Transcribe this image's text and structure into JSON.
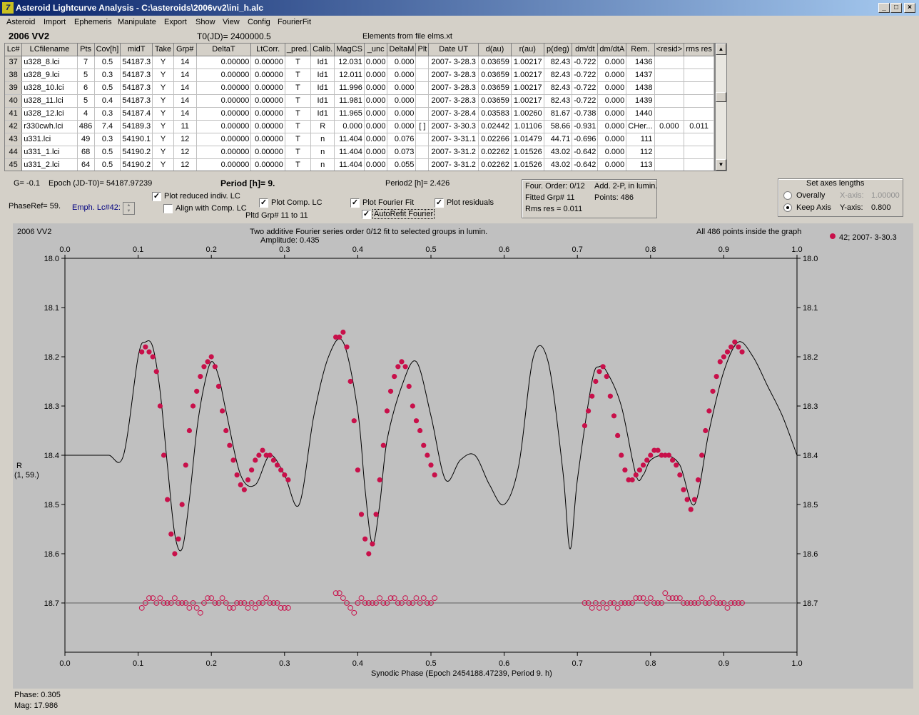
{
  "window": {
    "title": "Asteroid Lightcurve Analysis - C:\\asteroids\\2006vv2\\ini_h.alc",
    "app_icon": "lightcurve-app-icon",
    "minimize": "_",
    "maximize": "□",
    "close": "×"
  },
  "menu": [
    "Asteroid",
    "Import",
    "Ephemeris",
    "Manipulate",
    "Export",
    "Show",
    "View",
    "Config",
    "FourierFit"
  ],
  "header": {
    "object": "2006 VV2",
    "t0": "T0(JD)= 2400000.5",
    "elements": "Elements from file elms.xt"
  },
  "table": {
    "columns": [
      "Lc#",
      "LCfilename",
      "Pts",
      "Cov[h]",
      "midT",
      "Take",
      "Grp#",
      "DeltaT",
      "LtCorr.",
      "_pred.",
      "Calib.",
      "MagCS",
      "_unc",
      "DeltaM",
      "Plt",
      "Date UT",
      "d(au)",
      "r(au)",
      "p(deg)",
      "dm/dt",
      "dm/dtA",
      "Rem.",
      "<resid>",
      "rms res"
    ],
    "rows": [
      [
        "37",
        "u328_8.lci",
        "7",
        "0.5",
        "54187.3",
        "Y",
        "14",
        "0.00000",
        "0.00000",
        "T",
        "Id1",
        "12.031",
        "0.000",
        "0.000",
        "",
        "2007- 3-28.3",
        "0.03659",
        "1.00217",
        "82.43",
        "-0.722",
        "0.000",
        "1436",
        "",
        ""
      ],
      [
        "38",
        "u328_9.lci",
        "5",
        "0.3",
        "54187.3",
        "Y",
        "14",
        "0.00000",
        "0.00000",
        "T",
        "Id1",
        "12.011",
        "0.000",
        "0.000",
        "",
        "2007- 3-28.3",
        "0.03659",
        "1.00217",
        "82.43",
        "-0.722",
        "0.000",
        "1437",
        "",
        ""
      ],
      [
        "39",
        "u328_10.lci",
        "6",
        "0.5",
        "54187.3",
        "Y",
        "14",
        "0.00000",
        "0.00000",
        "T",
        "Id1",
        "11.996",
        "0.000",
        "0.000",
        "",
        "2007- 3-28.3",
        "0.03659",
        "1.00217",
        "82.43",
        "-0.722",
        "0.000",
        "1438",
        "",
        ""
      ],
      [
        "40",
        "u328_11.lci",
        "5",
        "0.4",
        "54187.3",
        "Y",
        "14",
        "0.00000",
        "0.00000",
        "T",
        "Id1",
        "11.981",
        "0.000",
        "0.000",
        "",
        "2007- 3-28.3",
        "0.03659",
        "1.00217",
        "82.43",
        "-0.722",
        "0.000",
        "1439",
        "",
        ""
      ],
      [
        "41",
        "u328_12.lci",
        "4",
        "0.3",
        "54187.4",
        "Y",
        "14",
        "0.00000",
        "0.00000",
        "T",
        "Id1",
        "11.965",
        "0.000",
        "0.000",
        "",
        "2007- 3-28.4",
        "0.03583",
        "1.00260",
        "81.67",
        "-0.738",
        "0.000",
        "1440",
        "",
        ""
      ],
      [
        "42",
        "r330cwh.lci",
        "486",
        "7.4",
        "54189.3",
        "Y",
        "11",
        "0.00000",
        "0.00000",
        "T",
        "R",
        "0.000",
        "0.000",
        "0.000",
        "[ ]",
        "2007- 3-30.3",
        "0.02442",
        "1.01106",
        "58.66",
        "-0.931",
        "0.000",
        "CHer...",
        "0.000",
        "0.011"
      ],
      [
        "43",
        "u331.lci",
        "49",
        "0.3",
        "54190.1",
        "Y",
        "12",
        "0.00000",
        "0.00000",
        "T",
        "n",
        "11.404",
        "0.000",
        "0.076",
        "",
        "2007- 3-31.1",
        "0.02266",
        "1.01479",
        "44.71",
        "-0.696",
        "0.000",
        "111",
        "",
        ""
      ],
      [
        "44",
        "u331_1.lci",
        "68",
        "0.5",
        "54190.2",
        "Y",
        "12",
        "0.00000",
        "0.00000",
        "T",
        "n",
        "11.404",
        "0.000",
        "0.073",
        "",
        "2007- 3-31.2",
        "0.02262",
        "1.01526",
        "43.02",
        "-0.642",
        "0.000",
        "112",
        "",
        ""
      ],
      [
        "45",
        "u331_2.lci",
        "64",
        "0.5",
        "54190.2",
        "Y",
        "12",
        "0.00000",
        "0.00000",
        "T",
        "n",
        "11.404",
        "0.000",
        "0.055",
        "",
        "2007- 3-31.2",
        "0.02262",
        "1.01526",
        "43.02",
        "-0.642",
        "0.000",
        "113",
        "",
        ""
      ]
    ]
  },
  "controls": {
    "g": "G= -0.1",
    "epoch": "Epoch (JD-T0)= 54187.97239",
    "period": "Period [h]= 9.",
    "period2": "Period2 [h]= 2.426",
    "phase_ref": "PhaseRef= 59.",
    "emph": "Emph. Lc#42:",
    "plot_reduced": "Plot reduced indiv. LC",
    "align_comp": "Align with Comp. LC",
    "plot_comp": "Plot Comp. LC",
    "pltd_grp": "Pltd Grp#  11 to   11",
    "plot_fourier": "Plot Fourier Fit",
    "autorefit": "AutoRefit Fourier",
    "plot_residuals": "Plot residuals"
  },
  "fourier_info": {
    "order": "Four. Order:  0/12",
    "add": "Add. 2-P, in lumin.",
    "fitted": "Fitted Grp# 11",
    "points": "Points: 486",
    "rms": "Rms res     = 0.011"
  },
  "axes_group": {
    "title": "Set axes lengths",
    "overally": "Overally",
    "keep_axis": "Keep Axis",
    "x_label": "X-axis:",
    "x_value": "1.00000",
    "y_label": "Y-axis:",
    "y_value": "0.800"
  },
  "plot": {
    "object": "2006 VV2",
    "subtitle": "Two additive Fourier series order 0/12 fit to selected groups in lumin.",
    "amplitude": "Amplitude: 0.435",
    "points_note": "All 486 points inside the graph",
    "legend": "42; 2007- 3-30.3",
    "ylabel_1": "R",
    "ylabel_2": "(1, 59.)",
    "xlabel": "Synodic Phase (Epoch 2454188.47239, Period 9. h)",
    "phase_readout": "Phase:  0.305",
    "mag_readout": "Mag:    17.986"
  },
  "chart_data": {
    "type": "scatter",
    "xlabel": "Synodic Phase (Epoch 2454188.47239, Period 9. h)",
    "ylabel": "R",
    "xlim": [
      0.0,
      1.0
    ],
    "ylim": [
      18.0,
      18.8
    ],
    "y_inverted": true,
    "xticks": [
      "0.0",
      "0.1",
      "0.2",
      "0.3",
      "0.4",
      "0.5",
      "0.6",
      "0.7",
      "0.8",
      "0.9",
      "1.0"
    ],
    "yticks": [
      "18.0",
      "18.1",
      "18.2",
      "18.3",
      "18.4",
      "18.5",
      "18.6",
      "18.7"
    ],
    "grid": false,
    "legend_position": "top-right",
    "colors": {
      "points": "#c8104a",
      "fit": "#000000",
      "residual_line": "#606060"
    },
    "fourier_fit": {
      "x": [
        0.0,
        0.02,
        0.04,
        0.06,
        0.08,
        0.1,
        0.11,
        0.12,
        0.13,
        0.14,
        0.15,
        0.16,
        0.17,
        0.18,
        0.19,
        0.2,
        0.21,
        0.22,
        0.24,
        0.26,
        0.28,
        0.3,
        0.32,
        0.34,
        0.36,
        0.38,
        0.4,
        0.41,
        0.42,
        0.43,
        0.44,
        0.46,
        0.48,
        0.5,
        0.52,
        0.54,
        0.56,
        0.58,
        0.6,
        0.62,
        0.64,
        0.66,
        0.68,
        0.69,
        0.7,
        0.72,
        0.73,
        0.74,
        0.76,
        0.78,
        0.79,
        0.8,
        0.82,
        0.84,
        0.86,
        0.88,
        0.9,
        0.92,
        0.94,
        0.96,
        0.98,
        1.0
      ],
      "y": [
        18.4,
        18.4,
        18.4,
        18.4,
        18.4,
        18.2,
        18.17,
        18.18,
        18.27,
        18.42,
        18.56,
        18.59,
        18.49,
        18.35,
        18.26,
        18.21,
        18.24,
        18.31,
        18.44,
        18.46,
        18.4,
        18.44,
        18.5,
        18.32,
        18.2,
        18.17,
        18.31,
        18.47,
        18.58,
        18.5,
        18.37,
        18.26,
        18.21,
        18.32,
        18.45,
        18.41,
        18.4,
        18.46,
        18.5,
        18.42,
        18.2,
        18.21,
        18.43,
        18.59,
        18.45,
        18.25,
        18.22,
        18.23,
        18.3,
        18.44,
        18.44,
        18.41,
        18.4,
        18.42,
        18.5,
        18.35,
        18.23,
        18.17,
        18.2,
        18.26,
        18.32,
        18.4
      ]
    },
    "observed_points": {
      "x": [
        0.105,
        0.11,
        0.115,
        0.12,
        0.125,
        0.13,
        0.135,
        0.14,
        0.145,
        0.15,
        0.155,
        0.16,
        0.165,
        0.17,
        0.175,
        0.18,
        0.185,
        0.19,
        0.195,
        0.2,
        0.205,
        0.21,
        0.215,
        0.22,
        0.225,
        0.23,
        0.235,
        0.24,
        0.245,
        0.25,
        0.255,
        0.26,
        0.265,
        0.27,
        0.275,
        0.28,
        0.285,
        0.29,
        0.295,
        0.3,
        0.305,
        0.37,
        0.375,
        0.38,
        0.385,
        0.39,
        0.395,
        0.4,
        0.405,
        0.41,
        0.415,
        0.42,
        0.425,
        0.43,
        0.435,
        0.44,
        0.445,
        0.45,
        0.455,
        0.46,
        0.465,
        0.47,
        0.475,
        0.48,
        0.485,
        0.49,
        0.495,
        0.5,
        0.505,
        0.71,
        0.715,
        0.72,
        0.725,
        0.73,
        0.735,
        0.74,
        0.745,
        0.75,
        0.755,
        0.76,
        0.765,
        0.77,
        0.775,
        0.78,
        0.785,
        0.79,
        0.795,
        0.8,
        0.805,
        0.81,
        0.815,
        0.82,
        0.825,
        0.83,
        0.835,
        0.84,
        0.845,
        0.85,
        0.855,
        0.86,
        0.865,
        0.87,
        0.875,
        0.88,
        0.885,
        0.89,
        0.895,
        0.9,
        0.905,
        0.91,
        0.915,
        0.92,
        0.925
      ],
      "y": [
        18.19,
        18.18,
        18.19,
        18.2,
        18.23,
        18.3,
        18.4,
        18.49,
        18.56,
        18.6,
        18.57,
        18.5,
        18.42,
        18.35,
        18.3,
        18.27,
        18.24,
        18.22,
        18.21,
        18.2,
        18.22,
        18.26,
        18.31,
        18.35,
        18.38,
        18.41,
        18.44,
        18.46,
        18.47,
        18.45,
        18.43,
        18.41,
        18.4,
        18.39,
        18.4,
        18.4,
        18.41,
        18.42,
        18.43,
        18.44,
        18.45,
        18.16,
        18.16,
        18.15,
        18.18,
        18.25,
        18.33,
        18.43,
        18.52,
        18.57,
        18.6,
        18.58,
        18.52,
        18.45,
        18.38,
        18.31,
        18.27,
        18.24,
        18.22,
        18.21,
        18.22,
        18.26,
        18.3,
        18.33,
        18.35,
        18.38,
        18.4,
        18.42,
        18.44,
        18.34,
        18.31,
        18.28,
        18.25,
        18.23,
        18.22,
        18.24,
        18.28,
        18.32,
        18.36,
        18.4,
        18.43,
        18.45,
        18.45,
        18.44,
        18.43,
        18.42,
        18.41,
        18.4,
        18.39,
        18.39,
        18.4,
        18.4,
        18.4,
        18.41,
        18.42,
        18.44,
        18.47,
        18.49,
        18.51,
        18.49,
        18.45,
        18.4,
        18.35,
        18.31,
        18.27,
        18.24,
        18.21,
        18.2,
        18.19,
        18.18,
        18.17,
        18.18,
        18.19
      ]
    },
    "residuals": {
      "x": [
        0.105,
        0.11,
        0.115,
        0.12,
        0.125,
        0.13,
        0.135,
        0.14,
        0.145,
        0.15,
        0.155,
        0.16,
        0.165,
        0.17,
        0.175,
        0.18,
        0.185,
        0.19,
        0.195,
        0.2,
        0.205,
        0.21,
        0.215,
        0.22,
        0.225,
        0.23,
        0.235,
        0.24,
        0.245,
        0.25,
        0.255,
        0.26,
        0.265,
        0.27,
        0.275,
        0.28,
        0.285,
        0.29,
        0.295,
        0.3,
        0.305,
        0.37,
        0.375,
        0.38,
        0.385,
        0.39,
        0.395,
        0.4,
        0.405,
        0.41,
        0.415,
        0.42,
        0.425,
        0.43,
        0.435,
        0.44,
        0.445,
        0.45,
        0.455,
        0.46,
        0.465,
        0.47,
        0.475,
        0.48,
        0.485,
        0.49,
        0.495,
        0.5,
        0.505,
        0.71,
        0.715,
        0.72,
        0.725,
        0.73,
        0.735,
        0.74,
        0.745,
        0.75,
        0.755,
        0.76,
        0.765,
        0.77,
        0.775,
        0.78,
        0.785,
        0.79,
        0.795,
        0.8,
        0.805,
        0.81,
        0.815,
        0.82,
        0.825,
        0.83,
        0.835,
        0.84,
        0.845,
        0.85,
        0.855,
        0.86,
        0.865,
        0.87,
        0.875,
        0.88,
        0.885,
        0.89,
        0.895,
        0.9,
        0.905,
        0.91,
        0.915,
        0.92,
        0.925
      ],
      "y": [
        18.71,
        18.7,
        18.69,
        18.69,
        18.7,
        18.69,
        18.7,
        18.7,
        18.7,
        18.69,
        18.7,
        18.7,
        18.7,
        18.71,
        18.7,
        18.71,
        18.72,
        18.7,
        18.69,
        18.69,
        18.7,
        18.7,
        18.69,
        18.7,
        18.71,
        18.71,
        18.7,
        18.7,
        18.7,
        18.71,
        18.7,
        18.71,
        18.7,
        18.7,
        18.69,
        18.7,
        18.7,
        18.7,
        18.71,
        18.71,
        18.71,
        18.68,
        18.68,
        18.69,
        18.7,
        18.71,
        18.72,
        18.7,
        18.69,
        18.7,
        18.7,
        18.7,
        18.7,
        18.69,
        18.7,
        18.7,
        18.69,
        18.69,
        18.7,
        18.7,
        18.69,
        18.7,
        18.7,
        18.69,
        18.7,
        18.69,
        18.7,
        18.7,
        18.69,
        18.7,
        18.7,
        18.71,
        18.7,
        18.71,
        18.7,
        18.71,
        18.7,
        18.7,
        18.71,
        18.7,
        18.7,
        18.7,
        18.7,
        18.69,
        18.69,
        18.69,
        18.7,
        18.69,
        18.7,
        18.7,
        18.7,
        18.68,
        18.69,
        18.69,
        18.69,
        18.69,
        18.7,
        18.7,
        18.7,
        18.7,
        18.7,
        18.69,
        18.7,
        18.7,
        18.69,
        18.7,
        18.7,
        18.7,
        18.71,
        18.7,
        18.7,
        18.7,
        18.7
      ]
    },
    "residual_baseline": 18.7
  }
}
